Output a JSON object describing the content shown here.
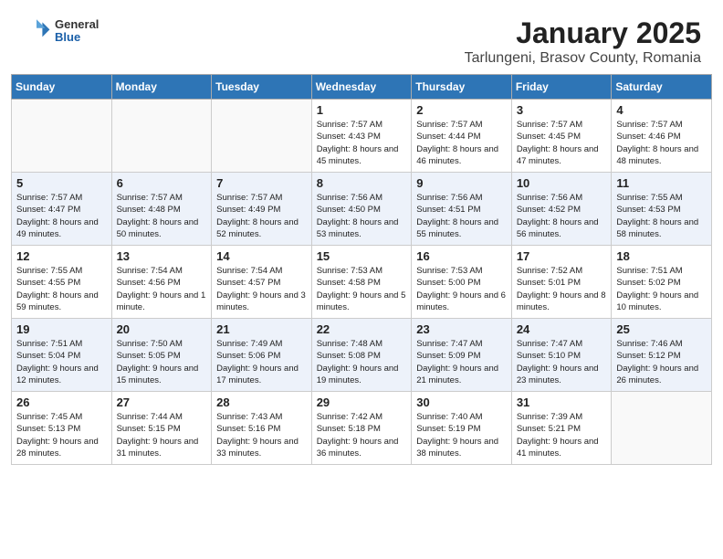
{
  "header": {
    "logo": {
      "general": "General",
      "blue": "Blue"
    },
    "title": "January 2025",
    "subtitle": "Tarlungeni, Brasov County, Romania"
  },
  "days_of_week": [
    "Sunday",
    "Monday",
    "Tuesday",
    "Wednesday",
    "Thursday",
    "Friday",
    "Saturday"
  ],
  "weeks": [
    [
      {
        "day": "",
        "sunrise": "",
        "sunset": "",
        "daylight": ""
      },
      {
        "day": "",
        "sunrise": "",
        "sunset": "",
        "daylight": ""
      },
      {
        "day": "",
        "sunrise": "",
        "sunset": "",
        "daylight": ""
      },
      {
        "day": "1",
        "sunrise": "Sunrise: 7:57 AM",
        "sunset": "Sunset: 4:43 PM",
        "daylight": "Daylight: 8 hours and 45 minutes."
      },
      {
        "day": "2",
        "sunrise": "Sunrise: 7:57 AM",
        "sunset": "Sunset: 4:44 PM",
        "daylight": "Daylight: 8 hours and 46 minutes."
      },
      {
        "day": "3",
        "sunrise": "Sunrise: 7:57 AM",
        "sunset": "Sunset: 4:45 PM",
        "daylight": "Daylight: 8 hours and 47 minutes."
      },
      {
        "day": "4",
        "sunrise": "Sunrise: 7:57 AM",
        "sunset": "Sunset: 4:46 PM",
        "daylight": "Daylight: 8 hours and 48 minutes."
      }
    ],
    [
      {
        "day": "5",
        "sunrise": "Sunrise: 7:57 AM",
        "sunset": "Sunset: 4:47 PM",
        "daylight": "Daylight: 8 hours and 49 minutes."
      },
      {
        "day": "6",
        "sunrise": "Sunrise: 7:57 AM",
        "sunset": "Sunset: 4:48 PM",
        "daylight": "Daylight: 8 hours and 50 minutes."
      },
      {
        "day": "7",
        "sunrise": "Sunrise: 7:57 AM",
        "sunset": "Sunset: 4:49 PM",
        "daylight": "Daylight: 8 hours and 52 minutes."
      },
      {
        "day": "8",
        "sunrise": "Sunrise: 7:56 AM",
        "sunset": "Sunset: 4:50 PM",
        "daylight": "Daylight: 8 hours and 53 minutes."
      },
      {
        "day": "9",
        "sunrise": "Sunrise: 7:56 AM",
        "sunset": "Sunset: 4:51 PM",
        "daylight": "Daylight: 8 hours and 55 minutes."
      },
      {
        "day": "10",
        "sunrise": "Sunrise: 7:56 AM",
        "sunset": "Sunset: 4:52 PM",
        "daylight": "Daylight: 8 hours and 56 minutes."
      },
      {
        "day": "11",
        "sunrise": "Sunrise: 7:55 AM",
        "sunset": "Sunset: 4:53 PM",
        "daylight": "Daylight: 8 hours and 58 minutes."
      }
    ],
    [
      {
        "day": "12",
        "sunrise": "Sunrise: 7:55 AM",
        "sunset": "Sunset: 4:55 PM",
        "daylight": "Daylight: 8 hours and 59 minutes."
      },
      {
        "day": "13",
        "sunrise": "Sunrise: 7:54 AM",
        "sunset": "Sunset: 4:56 PM",
        "daylight": "Daylight: 9 hours and 1 minute."
      },
      {
        "day": "14",
        "sunrise": "Sunrise: 7:54 AM",
        "sunset": "Sunset: 4:57 PM",
        "daylight": "Daylight: 9 hours and 3 minutes."
      },
      {
        "day": "15",
        "sunrise": "Sunrise: 7:53 AM",
        "sunset": "Sunset: 4:58 PM",
        "daylight": "Daylight: 9 hours and 5 minutes."
      },
      {
        "day": "16",
        "sunrise": "Sunrise: 7:53 AM",
        "sunset": "Sunset: 5:00 PM",
        "daylight": "Daylight: 9 hours and 6 minutes."
      },
      {
        "day": "17",
        "sunrise": "Sunrise: 7:52 AM",
        "sunset": "Sunset: 5:01 PM",
        "daylight": "Daylight: 9 hours and 8 minutes."
      },
      {
        "day": "18",
        "sunrise": "Sunrise: 7:51 AM",
        "sunset": "Sunset: 5:02 PM",
        "daylight": "Daylight: 9 hours and 10 minutes."
      }
    ],
    [
      {
        "day": "19",
        "sunrise": "Sunrise: 7:51 AM",
        "sunset": "Sunset: 5:04 PM",
        "daylight": "Daylight: 9 hours and 12 minutes."
      },
      {
        "day": "20",
        "sunrise": "Sunrise: 7:50 AM",
        "sunset": "Sunset: 5:05 PM",
        "daylight": "Daylight: 9 hours and 15 minutes."
      },
      {
        "day": "21",
        "sunrise": "Sunrise: 7:49 AM",
        "sunset": "Sunset: 5:06 PM",
        "daylight": "Daylight: 9 hours and 17 minutes."
      },
      {
        "day": "22",
        "sunrise": "Sunrise: 7:48 AM",
        "sunset": "Sunset: 5:08 PM",
        "daylight": "Daylight: 9 hours and 19 minutes."
      },
      {
        "day": "23",
        "sunrise": "Sunrise: 7:47 AM",
        "sunset": "Sunset: 5:09 PM",
        "daylight": "Daylight: 9 hours and 21 minutes."
      },
      {
        "day": "24",
        "sunrise": "Sunrise: 7:47 AM",
        "sunset": "Sunset: 5:10 PM",
        "daylight": "Daylight: 9 hours and 23 minutes."
      },
      {
        "day": "25",
        "sunrise": "Sunrise: 7:46 AM",
        "sunset": "Sunset: 5:12 PM",
        "daylight": "Daylight: 9 hours and 26 minutes."
      }
    ],
    [
      {
        "day": "26",
        "sunrise": "Sunrise: 7:45 AM",
        "sunset": "Sunset: 5:13 PM",
        "daylight": "Daylight: 9 hours and 28 minutes."
      },
      {
        "day": "27",
        "sunrise": "Sunrise: 7:44 AM",
        "sunset": "Sunset: 5:15 PM",
        "daylight": "Daylight: 9 hours and 31 minutes."
      },
      {
        "day": "28",
        "sunrise": "Sunrise: 7:43 AM",
        "sunset": "Sunset: 5:16 PM",
        "daylight": "Daylight: 9 hours and 33 minutes."
      },
      {
        "day": "29",
        "sunrise": "Sunrise: 7:42 AM",
        "sunset": "Sunset: 5:18 PM",
        "daylight": "Daylight: 9 hours and 36 minutes."
      },
      {
        "day": "30",
        "sunrise": "Sunrise: 7:40 AM",
        "sunset": "Sunset: 5:19 PM",
        "daylight": "Daylight: 9 hours and 38 minutes."
      },
      {
        "day": "31",
        "sunrise": "Sunrise: 7:39 AM",
        "sunset": "Sunset: 5:21 PM",
        "daylight": "Daylight: 9 hours and 41 minutes."
      },
      {
        "day": "",
        "sunrise": "",
        "sunset": "",
        "daylight": ""
      }
    ]
  ]
}
